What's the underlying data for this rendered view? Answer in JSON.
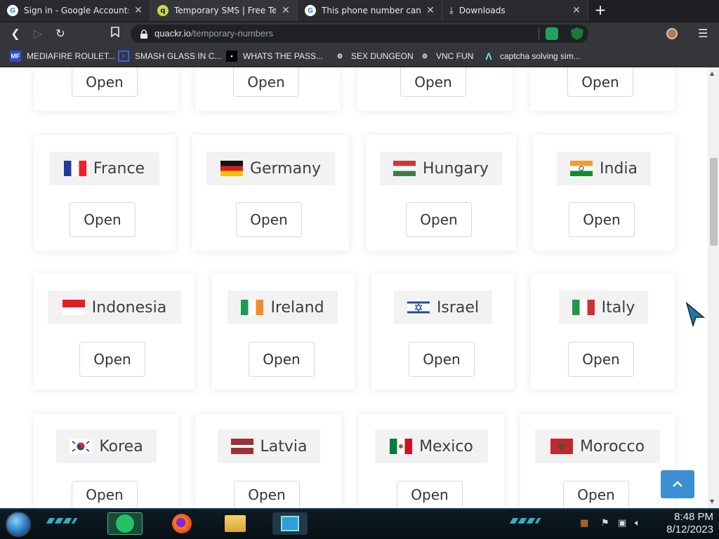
{
  "browser": {
    "tabs": [
      {
        "title": "Sign in - Google Accounts",
        "icon": "google-icon",
        "active": false
      },
      {
        "title": "Temporary SMS | Free Tempo",
        "icon": "quackr-icon",
        "active": true
      },
      {
        "title": "This phone number cannot b",
        "icon": "google-icon",
        "active": false
      },
      {
        "title": "Downloads",
        "icon": "download-icon",
        "active": false
      }
    ],
    "new_tab_label": "+",
    "url_host": "quackr.io",
    "url_path": "/temporary-numbers",
    "bookmarks": [
      {
        "label": "MEDIAFIRE ROULET...",
        "icon": "mediafire-icon"
      },
      {
        "label": "SMASH GLASS IN C...",
        "icon": "smash-icon"
      },
      {
        "label": "WHATS THE PASS...",
        "icon": "pass-icon"
      },
      {
        "label": "SEX DUNGEON",
        "icon": "dungeon-icon"
      },
      {
        "label": "VNC FUN",
        "icon": "vnc-icon"
      },
      {
        "label": "captcha solving sim...",
        "icon": "captcha-icon"
      }
    ]
  },
  "page": {
    "open_label": "Open",
    "countries": [
      {
        "name": "France",
        "flag": "france-flag"
      },
      {
        "name": "Germany",
        "flag": "germany-flag"
      },
      {
        "name": "Hungary",
        "flag": "hungary-flag"
      },
      {
        "name": "India",
        "flag": "india-flag"
      },
      {
        "name": "Indonesia",
        "flag": "indonesia-flag"
      },
      {
        "name": "Ireland",
        "flag": "ireland-flag"
      },
      {
        "name": "Israel",
        "flag": "israel-flag"
      },
      {
        "name": "Italy",
        "flag": "italy-flag"
      },
      {
        "name": "Korea",
        "flag": "korea-flag"
      },
      {
        "name": "Latvia",
        "flag": "latvia-flag"
      },
      {
        "name": "Mexico",
        "flag": "mexico-flag"
      },
      {
        "name": "Morocco",
        "flag": "morocco-flag"
      }
    ],
    "colors": {
      "accent": "#3d8fd1",
      "card_label_bg": "#f2f2f2"
    }
  },
  "taskbar": {
    "time": "8:48 PM",
    "date": "8/12/2023",
    "apps": [
      "chat-app-icon",
      "firefox-icon",
      "file-explorer-icon",
      "installer-icon"
    ]
  }
}
